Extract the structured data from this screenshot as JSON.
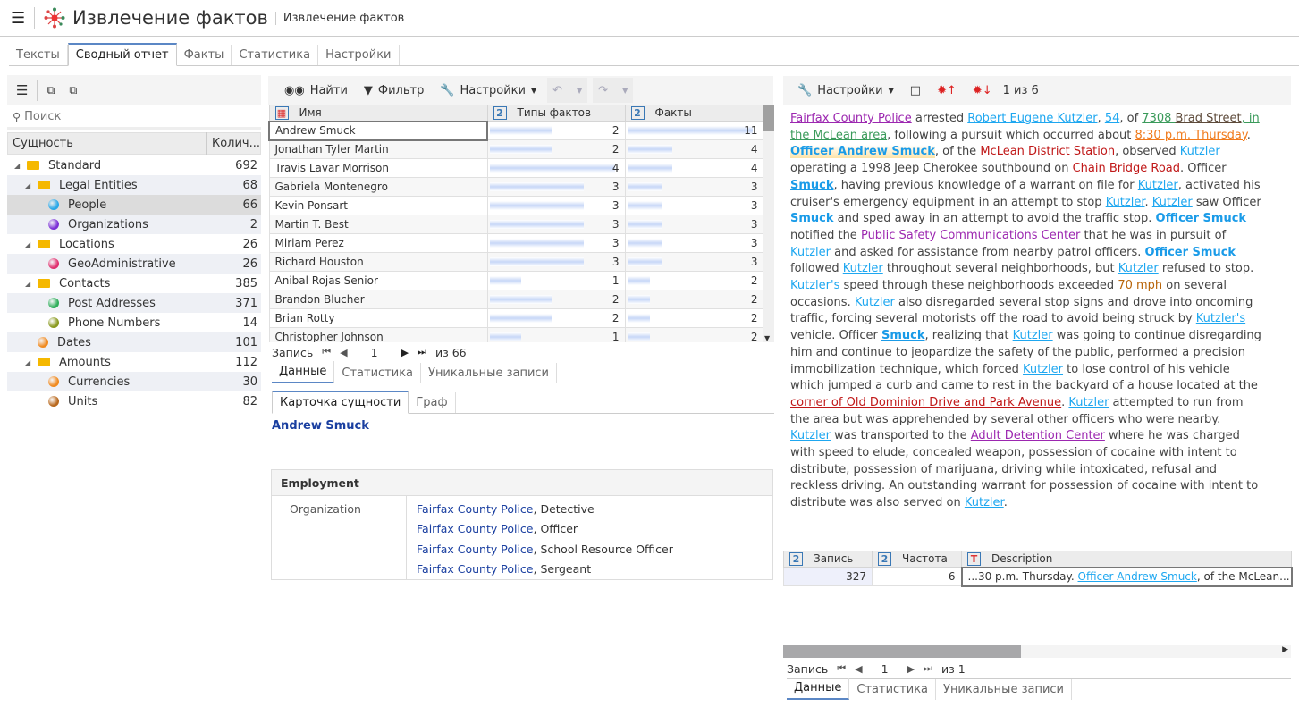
{
  "header": {
    "title": "Извлечение фактов",
    "subtitle": "Извлечение фактов"
  },
  "main_tabs": [
    {
      "label": "Тексты"
    },
    {
      "label": "Сводный отчет",
      "active": true
    },
    {
      "label": "Факты"
    },
    {
      "label": "Статистика"
    },
    {
      "label": "Настройки"
    }
  ],
  "left": {
    "search_placeholder": "Поиск",
    "col_entity": "Сущность",
    "col_count": "Колич...",
    "tree": [
      {
        "label": "Standard",
        "count": "692",
        "level": 0,
        "type": "folder"
      },
      {
        "label": "Legal Entities",
        "count": "68",
        "level": 1,
        "type": "folder"
      },
      {
        "label": "People",
        "count": "66",
        "level": 2,
        "type": "sphere",
        "color": "#2aa8e8",
        "selected": true
      },
      {
        "label": "Organizations",
        "count": "2",
        "level": 2,
        "type": "sphere",
        "color": "#7b2fd6"
      },
      {
        "label": "Locations",
        "count": "26",
        "level": 1,
        "type": "folder"
      },
      {
        "label": "GeoAdministrative",
        "count": "26",
        "level": 2,
        "type": "sphere",
        "color": "#e0306e"
      },
      {
        "label": "Contacts",
        "count": "385",
        "level": 1,
        "type": "folder"
      },
      {
        "label": "Post Addresses",
        "count": "371",
        "level": 2,
        "type": "sphere",
        "color": "#2fae5a"
      },
      {
        "label": "Phone Numbers",
        "count": "14",
        "level": 2,
        "type": "sphere",
        "color": "#8a9a20"
      },
      {
        "label": "Dates",
        "count": "101",
        "level": 1,
        "type": "sphere",
        "color": "#f08a20"
      },
      {
        "label": "Amounts",
        "count": "112",
        "level": 1,
        "type": "folder"
      },
      {
        "label": "Currencies",
        "count": "30",
        "level": 2,
        "type": "sphere",
        "color": "#f08a20"
      },
      {
        "label": "Units",
        "count": "82",
        "level": 2,
        "type": "sphere",
        "color": "#b8681e"
      }
    ]
  },
  "center": {
    "find": "Найти",
    "filter": "Фильтр",
    "settings": "Настройки",
    "columns": {
      "name": "Имя",
      "types": "Типы фактов",
      "facts": "Факты"
    },
    "rows": [
      {
        "name": "Andrew Smuck",
        "types": 2,
        "facts": 11
      },
      {
        "name": "Jonathan Tyler Martin",
        "types": 2,
        "facts": 4
      },
      {
        "name": "Travis Lavar Morrison",
        "types": 4,
        "facts": 4
      },
      {
        "name": "Gabriela Montenegro",
        "types": 3,
        "facts": 3
      },
      {
        "name": "Kevin Ponsart",
        "types": 3,
        "facts": 3
      },
      {
        "name": "Martin T. Best",
        "types": 3,
        "facts": 3
      },
      {
        "name": "Miriam Perez",
        "types": 3,
        "facts": 3
      },
      {
        "name": "Richard Houston",
        "types": 3,
        "facts": 3
      },
      {
        "name": "Anibal Rojas Senior",
        "types": 1,
        "facts": 2
      },
      {
        "name": "Brandon Blucher",
        "types": 2,
        "facts": 2
      },
      {
        "name": "Brian Rotty",
        "types": 2,
        "facts": 2
      },
      {
        "name": "Christopher Johnson",
        "types": 1,
        "facts": 2
      }
    ],
    "pager": {
      "label": "Запись",
      "page": "1",
      "of": "из 66"
    },
    "bottom_tabs": [
      {
        "label": "Данные"
      },
      {
        "label": "Статистика"
      },
      {
        "label": "Уникальные записи"
      }
    ],
    "card_tabs": [
      {
        "label": "Карточка сущности"
      },
      {
        "label": "Граф"
      }
    ],
    "card": {
      "title": "Andrew Smuck",
      "section": "Employment",
      "field": "Organization",
      "values": [
        {
          "org": "Fairfax County Police",
          "role": ", Detective"
        },
        {
          "org": "Fairfax County Police",
          "role": ", Officer"
        },
        {
          "org": "Fairfax County Police",
          "role": ", School Resource Officer"
        },
        {
          "org": "Fairfax County Police",
          "role": ", Sergeant"
        }
      ]
    }
  },
  "right": {
    "settings": "Настройки",
    "counter": "1 из 6",
    "colors": {
      "org": "#9c27b0",
      "person": "#1ea7f0",
      "address": "#3a9a5a",
      "street": "#5d4a3a",
      "date": "#f07a1a",
      "location": "#c01818",
      "speed": "#b8650a"
    },
    "text": [
      {
        "t": "Fairfax County Police",
        "k": "org"
      },
      {
        "t": " arrested "
      },
      {
        "t": "Robert Eugene Kutzler",
        "k": "person"
      },
      {
        "t": ", "
      },
      {
        "t": "54",
        "k": "person"
      },
      {
        "t": ", of "
      },
      {
        "t": "7308 ",
        "k": "address"
      },
      {
        "t": "Brad Street",
        "k": "street"
      },
      {
        "t": ", in the McLean area",
        "k": "address"
      },
      {
        "t": ", following a pursuit which occurred about "
      },
      {
        "t": "8:30 p.m. Thursday",
        "k": "date"
      },
      {
        "t": ". "
      },
      {
        "t": "Officer Andrew Smuck",
        "k": "hl"
      },
      {
        "t": ", of the "
      },
      {
        "t": "McLean District Station",
        "k": "location"
      },
      {
        "t": ", observed "
      },
      {
        "t": "Kutzler",
        "k": "person"
      },
      {
        "t": " operating a 1998 Jeep Cherokee southbound on "
      },
      {
        "t": "Chain Bridge Road",
        "k": "location"
      },
      {
        "t": ". Officer "
      },
      {
        "t": "Smuck",
        "k": "bold"
      },
      {
        "t": ", having previous knowledge of a warrant on file for "
      },
      {
        "t": "Kutzler",
        "k": "person"
      },
      {
        "t": ", activated his cruiser's emergency equipment in an attempt to stop "
      },
      {
        "t": "Kutzler",
        "k": "person"
      },
      {
        "t": ". "
      },
      {
        "t": "Kutzler",
        "k": "person"
      },
      {
        "t": " saw Officer "
      },
      {
        "t": "Smuck",
        "k": "bold"
      },
      {
        "t": " and sped away in an attempt to avoid the traffic stop. "
      },
      {
        "t": "Officer Smuck",
        "k": "bold"
      },
      {
        "t": " notified the "
      },
      {
        "t": "Public Safety Communications Center",
        "k": "org"
      },
      {
        "t": " that he was in pursuit of "
      },
      {
        "t": "Kutzler",
        "k": "person"
      },
      {
        "t": " and asked for assistance from nearby patrol officers. "
      },
      {
        "t": "Officer Smuck",
        "k": "bold"
      },
      {
        "t": " followed "
      },
      {
        "t": "Kutzler",
        "k": "person"
      },
      {
        "t": " throughout several neighborhoods, but "
      },
      {
        "t": "Kutzler",
        "k": "person"
      },
      {
        "t": " refused to stop. "
      },
      {
        "t": "Kutzler's",
        "k": "person"
      },
      {
        "t": " speed through these neighborhoods exceeded "
      },
      {
        "t": "70 mph",
        "k": "speed"
      },
      {
        "t": " on several occasions. "
      },
      {
        "t": "Kutzler",
        "k": "person"
      },
      {
        "t": " also disregarded several stop signs and drove into oncoming traffic, forcing several motorists off the road to avoid being struck by "
      },
      {
        "t": "Kutzler's",
        "k": "person"
      },
      {
        "t": " vehicle. Officer "
      },
      {
        "t": "Smuck",
        "k": "bold"
      },
      {
        "t": ", realizing that "
      },
      {
        "t": "Kutzler",
        "k": "person"
      },
      {
        "t": " was going to continue disregarding him and continue to jeopardize the safety of the public, performed a precision immobilization technique, which forced "
      },
      {
        "t": "Kutzler",
        "k": "person"
      },
      {
        "t": " to lose control of his vehicle which jumped a curb and came to rest in the backyard of a house located at the "
      },
      {
        "t": "corner of Old Dominion Drive and Park Avenue",
        "k": "location"
      },
      {
        "t": ". "
      },
      {
        "t": "Kutzler",
        "k": "person"
      },
      {
        "t": " attempted to run from the area but was apprehended by several other officers who were nearby. "
      },
      {
        "t": "Kutzler",
        "k": "person"
      },
      {
        "t": " was transported to the "
      },
      {
        "t": "Adult Detention Center",
        "k": "org"
      },
      {
        "t": " where he was charged with speed to elude, concealed weapon, possession of cocaine with intent to distribute, possession of marijuana, driving while intoxicated, refusal and reckless driving. An outstanding warrant for possession of cocaine with intent to distribute was also served on "
      },
      {
        "t": "Kutzler",
        "k": "person"
      },
      {
        "t": "."
      }
    ],
    "table": {
      "col_record": "Запись",
      "col_freq": "Частота",
      "col_desc": "Description",
      "record": "327",
      "freq": "6",
      "desc_pre": "...30 p.m. Thursday. ",
      "desc_link": "Officer Andrew Smuck",
      "desc_post": ", of the McLean..."
    },
    "pager": {
      "label": "Запись",
      "page": "1",
      "of": "из 1"
    },
    "bottom_tabs": [
      {
        "label": "Данные"
      },
      {
        "label": "Статистика"
      },
      {
        "label": "Уникальные записи"
      }
    ]
  }
}
